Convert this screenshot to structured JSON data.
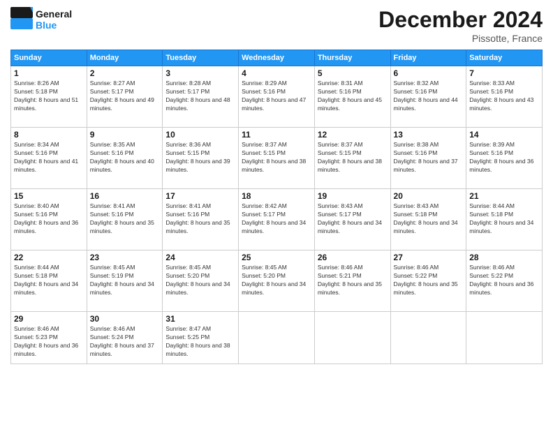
{
  "header": {
    "logo_general": "General",
    "logo_blue": "Blue",
    "month_title": "December 2024",
    "location": "Pissotte, France"
  },
  "days_of_week": [
    "Sunday",
    "Monday",
    "Tuesday",
    "Wednesday",
    "Thursday",
    "Friday",
    "Saturday"
  ],
  "weeks": [
    [
      {
        "day": "1",
        "sunrise": "Sunrise: 8:26 AM",
        "sunset": "Sunset: 5:18 PM",
        "daylight": "Daylight: 8 hours and 51 minutes."
      },
      {
        "day": "2",
        "sunrise": "Sunrise: 8:27 AM",
        "sunset": "Sunset: 5:17 PM",
        "daylight": "Daylight: 8 hours and 49 minutes."
      },
      {
        "day": "3",
        "sunrise": "Sunrise: 8:28 AM",
        "sunset": "Sunset: 5:17 PM",
        "daylight": "Daylight: 8 hours and 48 minutes."
      },
      {
        "day": "4",
        "sunrise": "Sunrise: 8:29 AM",
        "sunset": "Sunset: 5:16 PM",
        "daylight": "Daylight: 8 hours and 47 minutes."
      },
      {
        "day": "5",
        "sunrise": "Sunrise: 8:31 AM",
        "sunset": "Sunset: 5:16 PM",
        "daylight": "Daylight: 8 hours and 45 minutes."
      },
      {
        "day": "6",
        "sunrise": "Sunrise: 8:32 AM",
        "sunset": "Sunset: 5:16 PM",
        "daylight": "Daylight: 8 hours and 44 minutes."
      },
      {
        "day": "7",
        "sunrise": "Sunrise: 8:33 AM",
        "sunset": "Sunset: 5:16 PM",
        "daylight": "Daylight: 8 hours and 43 minutes."
      }
    ],
    [
      {
        "day": "8",
        "sunrise": "Sunrise: 8:34 AM",
        "sunset": "Sunset: 5:16 PM",
        "daylight": "Daylight: 8 hours and 41 minutes."
      },
      {
        "day": "9",
        "sunrise": "Sunrise: 8:35 AM",
        "sunset": "Sunset: 5:16 PM",
        "daylight": "Daylight: 8 hours and 40 minutes."
      },
      {
        "day": "10",
        "sunrise": "Sunrise: 8:36 AM",
        "sunset": "Sunset: 5:15 PM",
        "daylight": "Daylight: 8 hours and 39 minutes."
      },
      {
        "day": "11",
        "sunrise": "Sunrise: 8:37 AM",
        "sunset": "Sunset: 5:15 PM",
        "daylight": "Daylight: 8 hours and 38 minutes."
      },
      {
        "day": "12",
        "sunrise": "Sunrise: 8:37 AM",
        "sunset": "Sunset: 5:15 PM",
        "daylight": "Daylight: 8 hours and 38 minutes."
      },
      {
        "day": "13",
        "sunrise": "Sunrise: 8:38 AM",
        "sunset": "Sunset: 5:16 PM",
        "daylight": "Daylight: 8 hours and 37 minutes."
      },
      {
        "day": "14",
        "sunrise": "Sunrise: 8:39 AM",
        "sunset": "Sunset: 5:16 PM",
        "daylight": "Daylight: 8 hours and 36 minutes."
      }
    ],
    [
      {
        "day": "15",
        "sunrise": "Sunrise: 8:40 AM",
        "sunset": "Sunset: 5:16 PM",
        "daylight": "Daylight: 8 hours and 36 minutes."
      },
      {
        "day": "16",
        "sunrise": "Sunrise: 8:41 AM",
        "sunset": "Sunset: 5:16 PM",
        "daylight": "Daylight: 8 hours and 35 minutes."
      },
      {
        "day": "17",
        "sunrise": "Sunrise: 8:41 AM",
        "sunset": "Sunset: 5:16 PM",
        "daylight": "Daylight: 8 hours and 35 minutes."
      },
      {
        "day": "18",
        "sunrise": "Sunrise: 8:42 AM",
        "sunset": "Sunset: 5:17 PM",
        "daylight": "Daylight: 8 hours and 34 minutes."
      },
      {
        "day": "19",
        "sunrise": "Sunrise: 8:43 AM",
        "sunset": "Sunset: 5:17 PM",
        "daylight": "Daylight: 8 hours and 34 minutes."
      },
      {
        "day": "20",
        "sunrise": "Sunrise: 8:43 AM",
        "sunset": "Sunset: 5:18 PM",
        "daylight": "Daylight: 8 hours and 34 minutes."
      },
      {
        "day": "21",
        "sunrise": "Sunrise: 8:44 AM",
        "sunset": "Sunset: 5:18 PM",
        "daylight": "Daylight: 8 hours and 34 minutes."
      }
    ],
    [
      {
        "day": "22",
        "sunrise": "Sunrise: 8:44 AM",
        "sunset": "Sunset: 5:18 PM",
        "daylight": "Daylight: 8 hours and 34 minutes."
      },
      {
        "day": "23",
        "sunrise": "Sunrise: 8:45 AM",
        "sunset": "Sunset: 5:19 PM",
        "daylight": "Daylight: 8 hours and 34 minutes."
      },
      {
        "day": "24",
        "sunrise": "Sunrise: 8:45 AM",
        "sunset": "Sunset: 5:20 PM",
        "daylight": "Daylight: 8 hours and 34 minutes."
      },
      {
        "day": "25",
        "sunrise": "Sunrise: 8:45 AM",
        "sunset": "Sunset: 5:20 PM",
        "daylight": "Daylight: 8 hours and 34 minutes."
      },
      {
        "day": "26",
        "sunrise": "Sunrise: 8:46 AM",
        "sunset": "Sunset: 5:21 PM",
        "daylight": "Daylight: 8 hours and 35 minutes."
      },
      {
        "day": "27",
        "sunrise": "Sunrise: 8:46 AM",
        "sunset": "Sunset: 5:22 PM",
        "daylight": "Daylight: 8 hours and 35 minutes."
      },
      {
        "day": "28",
        "sunrise": "Sunrise: 8:46 AM",
        "sunset": "Sunset: 5:22 PM",
        "daylight": "Daylight: 8 hours and 36 minutes."
      }
    ],
    [
      {
        "day": "29",
        "sunrise": "Sunrise: 8:46 AM",
        "sunset": "Sunset: 5:23 PM",
        "daylight": "Daylight: 8 hours and 36 minutes."
      },
      {
        "day": "30",
        "sunrise": "Sunrise: 8:46 AM",
        "sunset": "Sunset: 5:24 PM",
        "daylight": "Daylight: 8 hours and 37 minutes."
      },
      {
        "day": "31",
        "sunrise": "Sunrise: 8:47 AM",
        "sunset": "Sunset: 5:25 PM",
        "daylight": "Daylight: 8 hours and 38 minutes."
      },
      null,
      null,
      null,
      null
    ]
  ]
}
